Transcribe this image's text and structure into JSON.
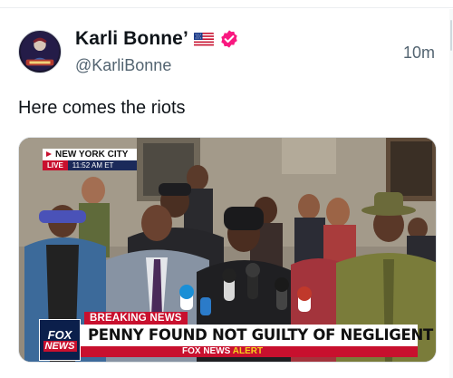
{
  "post": {
    "author": {
      "display_name": "Karli Bonne’",
      "handle": "@KarliBonne",
      "badges": [
        "us-flag-icon",
        "verified-icon"
      ],
      "verified_color": "#f91880"
    },
    "timestamp": "10m",
    "text": "Here comes the riots",
    "media": {
      "type": "video-still",
      "location": "NEW YORK CITY",
      "live_label": "LIVE",
      "live_time": "11:52 AM ET",
      "breaking_label": "BREAKING NEWS",
      "headline": "PENNY FOUND NOT GUILTY OF NEGLIGENT HOMICIDE",
      "alert_prefix": "FOX NEWS",
      "alert_word": "ALERT",
      "network_logo_line1": "FOX",
      "network_logo_line2": "NEWS",
      "brand_red": "#c8102e",
      "brand_navy": "#0b1f4b"
    }
  }
}
